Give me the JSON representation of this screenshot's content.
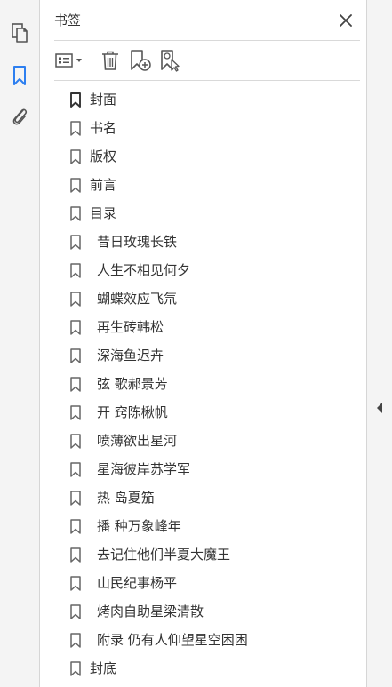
{
  "left_rail": {
    "buttons": [
      {
        "name": "pages-icon"
      },
      {
        "name": "bookmark-icon",
        "active": true
      },
      {
        "name": "paperclip-icon"
      }
    ],
    "accent_color": "#2d7ff0"
  },
  "panel": {
    "title": "书签",
    "close_icon": "close-icon"
  },
  "toolbar": {
    "buttons": [
      {
        "name": "options-menu-icon"
      },
      {
        "name": "trash-icon"
      },
      {
        "name": "add-bookmark-icon"
      },
      {
        "name": "find-bookmark-icon"
      }
    ]
  },
  "bookmarks": [
    {
      "label": "封面",
      "level": 0
    },
    {
      "label": "书名",
      "level": 0
    },
    {
      "label": "版权",
      "level": 0
    },
    {
      "label": "前言",
      "level": 0
    },
    {
      "label": "目录",
      "level": 0
    },
    {
      "label": "昔日玫瑰长铁",
      "level": 1
    },
    {
      "label": "人生不相见何夕",
      "level": 1
    },
    {
      "label": "蝴蝶效应飞氘",
      "level": 1
    },
    {
      "label": "再生砖韩松",
      "level": 1
    },
    {
      "label": "深海鱼迟卉",
      "level": 1
    },
    {
      "label": "弦 歌郝景芳",
      "level": 1
    },
    {
      "label": "开 窍陈楸帆",
      "level": 1
    },
    {
      "label": "喷薄欲出星河",
      "level": 1
    },
    {
      "label": "星海彼岸苏学军",
      "level": 1
    },
    {
      "label": "热 岛夏笳",
      "level": 1
    },
    {
      "label": "播 种万象峰年",
      "level": 1
    },
    {
      "label": "去记住他们半夏大魔王",
      "level": 1
    },
    {
      "label": "山民纪事杨平",
      "level": 1
    },
    {
      "label": "烤肉自助星梁清散",
      "level": 1
    },
    {
      "label": "附录 仍有人仰望星空困困",
      "level": 1
    },
    {
      "label": "封底",
      "level": 0
    }
  ],
  "right_rail": {
    "collapse_icon": "collapse-arrow-icon"
  }
}
